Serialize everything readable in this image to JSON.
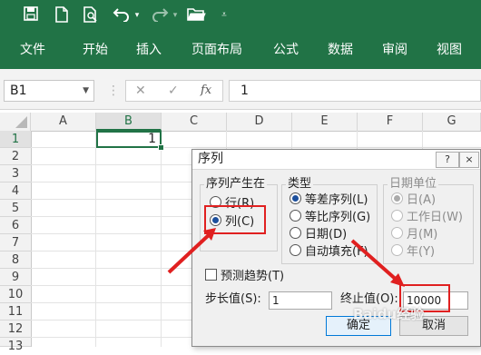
{
  "qat": {
    "icons": [
      "save-icon",
      "new-file-icon",
      "print-preview-icon",
      "undo-icon",
      "redo-icon",
      "open-folder-icon",
      "customize-qat-icon"
    ]
  },
  "ribbon": {
    "tabs": [
      "文件",
      "开始",
      "插入",
      "页面布局",
      "公式",
      "数据",
      "审阅",
      "视图"
    ]
  },
  "formula_bar": {
    "name_box": "B1",
    "fx_label": "fx",
    "formula_value": "1"
  },
  "sheet": {
    "columns": [
      "A",
      "B",
      "C",
      "D",
      "E",
      "F",
      "G"
    ],
    "rows": [
      "1",
      "2",
      "3",
      "4",
      "5",
      "6",
      "7",
      "8",
      "9",
      "10",
      "11",
      "12",
      "13"
    ],
    "selected_cell": {
      "address": "B1",
      "value": "1"
    }
  },
  "dialog": {
    "title": "序列",
    "help_label": "?",
    "close_label": "×",
    "series_in": {
      "label": "序列产生在",
      "options": [
        "行(R)",
        "列(C)"
      ],
      "selected": "列(C)"
    },
    "type": {
      "label": "类型",
      "options": [
        "等差序列(L)",
        "等比序列(G)",
        "日期(D)",
        "自动填充(F)"
      ],
      "selected": "等差序列(L)"
    },
    "date_unit": {
      "label": "日期单位",
      "options": [
        "日(A)",
        "工作日(W)",
        "月(M)",
        "年(Y)"
      ],
      "selected": "日(A)",
      "disabled": true
    },
    "trend_label": "预测趋势(T)",
    "step_label": "步长值(S):",
    "step_value": "1",
    "stop_label": "终止值(O):",
    "stop_value": "10000",
    "ok_label": "确定",
    "cancel_label": "取消"
  },
  "watermark": "Baidu经验",
  "colors": {
    "excel_green": "#217346",
    "highlight_red": "#e02020"
  }
}
